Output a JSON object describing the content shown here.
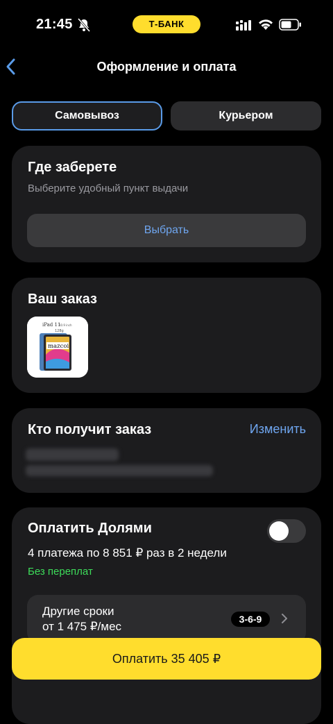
{
  "status_bar": {
    "time": "21:45",
    "bank_label": "Т-БАНК",
    "icons": [
      "bell-off-icon",
      "signal-icon",
      "wifi-icon",
      "battery-icon"
    ]
  },
  "nav": {
    "title": "Оформление и оплата",
    "back_icon": "chevron-left-icon"
  },
  "delivery_tabs": {
    "pickup": "Самовывоз",
    "courier": "Курьером",
    "selected": "pickup"
  },
  "pickup_card": {
    "title": "Где заберете",
    "subtitle": "Выберите удобный пункт выдачи",
    "button": "Выбрать"
  },
  "order_card": {
    "title": "Ваш заказ",
    "product_thumb_text": {
      "model": "iPad 11",
      "storage": "128g",
      "note": "10.9 inch",
      "brand": "mazcoi"
    }
  },
  "recipient_card": {
    "title": "Кто получит заказ",
    "change": "Изменить"
  },
  "dolyami_card": {
    "title": "Оплатить Долями",
    "installments": "4 платежа по 8 851 ₽ раз в 2 недели",
    "no_overpay": "Без переплат",
    "toggle_on": false,
    "other_terms": {
      "line1": "Другие сроки",
      "line2": "от 1 475 ₽/мес",
      "badge": "3-6-9"
    }
  },
  "pay_button": "Оплатить 35 405 ₽",
  "colors": {
    "accent_yellow": "#FFDD2D",
    "link_blue": "#6FA6F0",
    "success_green": "#3DDC5A",
    "card_bg": "#1C1C1E"
  }
}
